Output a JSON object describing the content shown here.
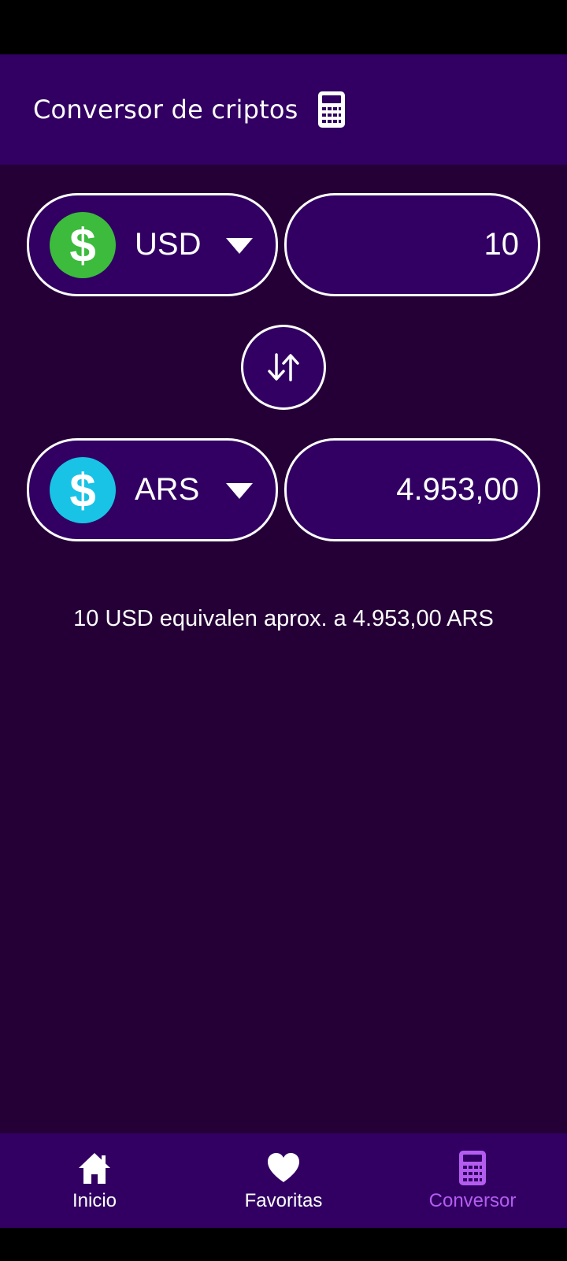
{
  "header": {
    "title": "Conversor de criptos",
    "icon": "calculator-icon"
  },
  "from": {
    "currency": "USD",
    "icon": "dollar-coin-icon",
    "color": "#3cbb3c",
    "amount": "10"
  },
  "to": {
    "currency": "ARS",
    "icon": "dollar-coin-icon",
    "color": "#19c3e6",
    "amount": "4.953,00"
  },
  "swap": {
    "icon": "swap-arrows-icon"
  },
  "result_text": "10 USD equivalen aprox. a 4.953,00 ARS",
  "nav": {
    "items": [
      {
        "label": "Inicio",
        "icon": "home-icon",
        "active": false
      },
      {
        "label": "Favoritas",
        "icon": "heart-icon",
        "active": false
      },
      {
        "label": "Conversor",
        "icon": "calculator-icon",
        "active": true
      }
    ],
    "active_color": "#b45cf0"
  },
  "colors": {
    "header_bg": "#310062",
    "main_bg": "#250037"
  }
}
